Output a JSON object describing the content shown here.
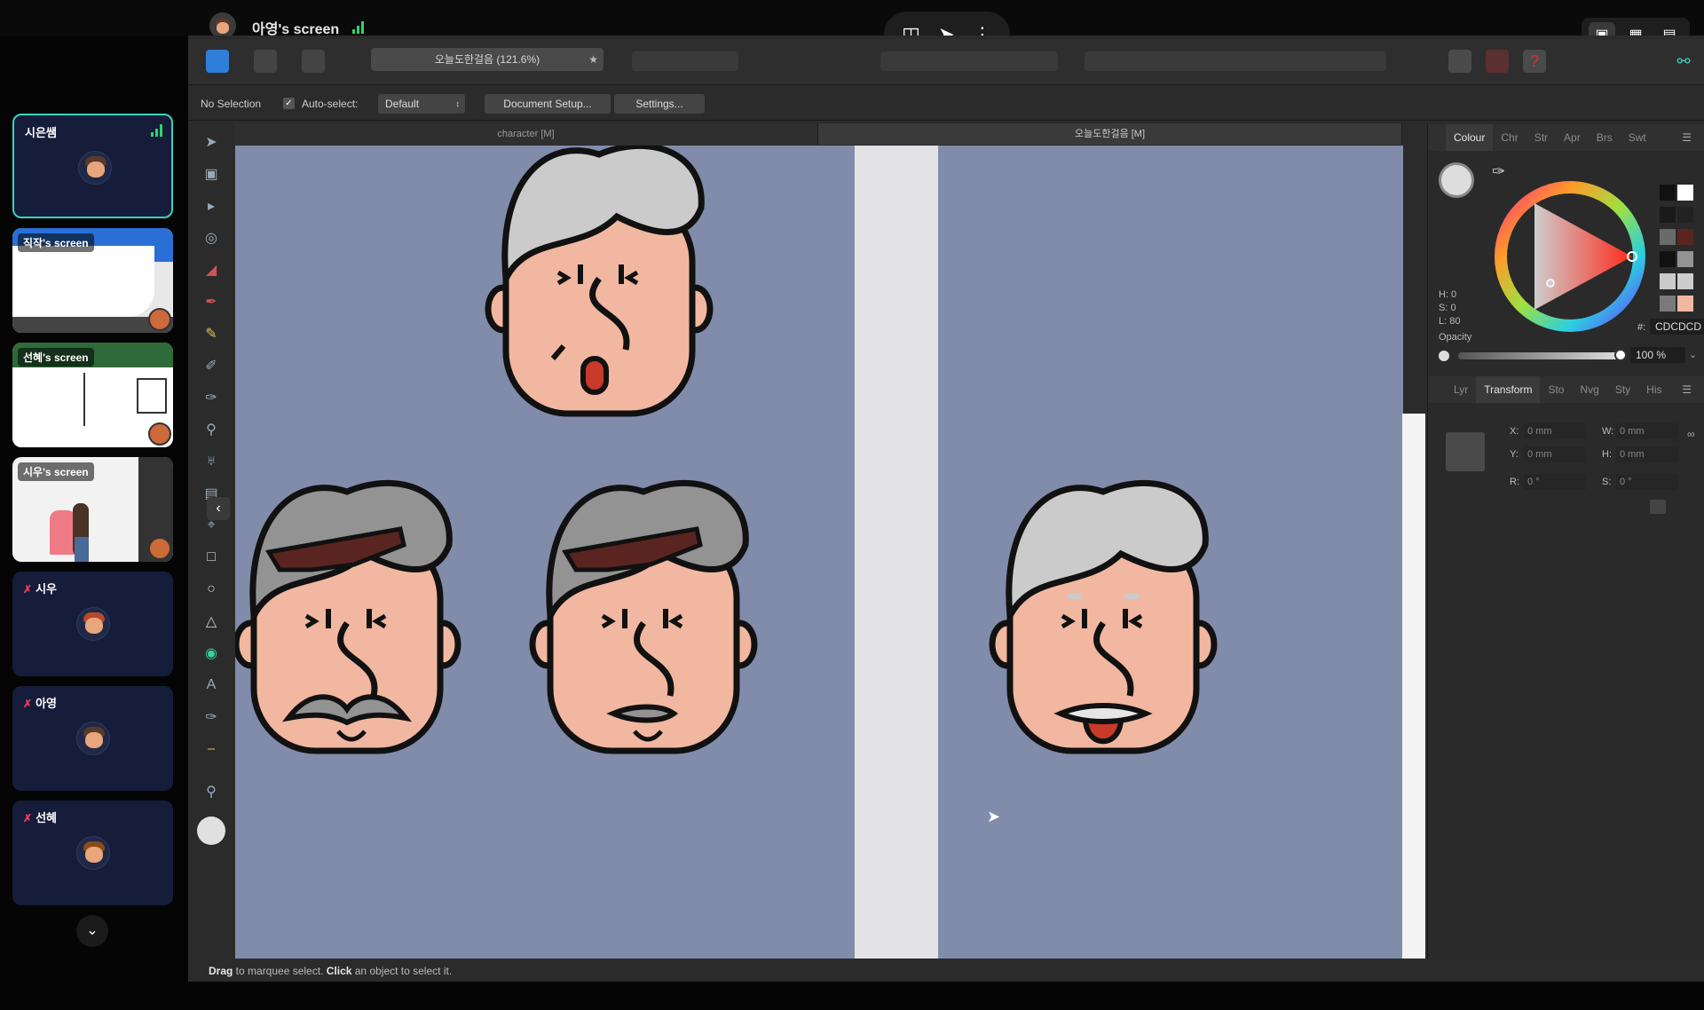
{
  "share": {
    "title": "아영's screen",
    "icons": [
      "screen-icon",
      "pointer-icon",
      "more-icon"
    ],
    "view_icons": [
      "monitor-icon",
      "grid-icon",
      "sidebar-layout-icon"
    ]
  },
  "participants": [
    {
      "name": "시은쌤",
      "type": "camera",
      "active": true
    },
    {
      "name": "직작's screen",
      "type": "screen"
    },
    {
      "name": "선혜's screen",
      "type": "screen"
    },
    {
      "name": "시우's screen",
      "type": "screen"
    },
    {
      "name": "시우",
      "type": "camera",
      "muted": true
    },
    {
      "name": "아영",
      "type": "camera",
      "muted": true
    },
    {
      "name": "선혜",
      "type": "camera",
      "muted": true
    }
  ],
  "app": {
    "doc_title": "오늘도한걸음 (121.6%)",
    "context": {
      "selection": "No Selection",
      "auto_select_label": "Auto-select:",
      "auto_select_value": "Default",
      "document_setup": "Document Setup...",
      "settings": "Settings..."
    },
    "doc_tabs": [
      {
        "label": "character [M]",
        "active": false
      },
      {
        "label": "오늘도한걸음 [M]",
        "active": true
      }
    ],
    "status": {
      "drag": "Drag",
      "t1": " to marquee select. ",
      "click": "Click",
      "t2": " an object to select it."
    }
  },
  "panel_top": {
    "tabs": [
      "Colour",
      "Chr",
      "Str",
      "Apr",
      "Brs",
      "Swt"
    ],
    "active": "Colour",
    "h": "H: 0",
    "s": "S: 0",
    "l": "L: 80",
    "hex_label": "#:",
    "hex_value": "CDCDCD",
    "opacity_label": "Opacity",
    "opacity_value": "100 %"
  },
  "panel_bottom": {
    "tabs": [
      "Lyr",
      "Transform",
      "Sto",
      "Nvg",
      "Sty",
      "His"
    ],
    "active": "Transform",
    "fields": {
      "x_label": "X:",
      "x": "0 mm",
      "y_label": "Y:",
      "y": "0 mm",
      "w_label": "W:",
      "w": "0 mm",
      "h_label": "H:",
      "h": "0 mm",
      "r_label": "R:",
      "r": "0 °",
      "s_label": "S:",
      "s": "0 °"
    }
  },
  "colors": {
    "canvas": "#818caa",
    "skin": "#f2b7a0",
    "hair_light": "#cbcbcb",
    "hair_dark": "#939393",
    "accent_teal": "#3ad3c0"
  }
}
